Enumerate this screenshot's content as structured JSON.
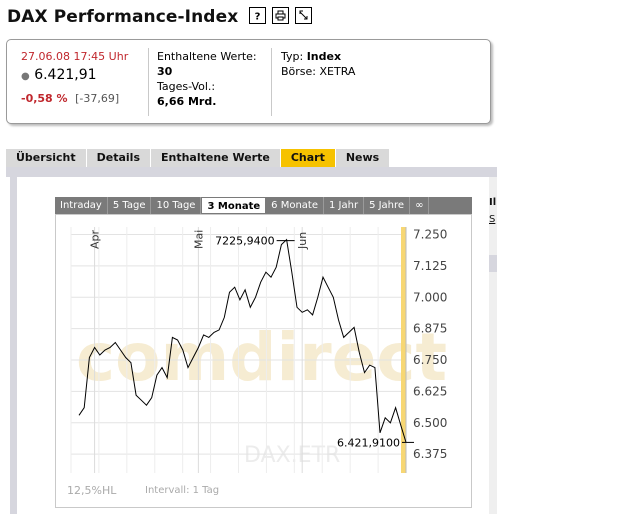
{
  "page": {
    "title": "DAX Performance-Index"
  },
  "toolbar": {
    "icons": [
      "help-icon",
      "print-icon",
      "refresh-icon"
    ]
  },
  "summary": {
    "timestamp": "27.06.08  17:45 Uhr",
    "price": "6.421,91",
    "change_pct": "-0,58 %",
    "change_abs": "[-37,69]",
    "constituents_label": "Enthaltene Werte:",
    "constituents_value": "30",
    "volume_label": "Tages-Vol.:",
    "volume_value": "6,66 Mrd.",
    "type_label": "Typ:",
    "type_value": "Index",
    "exchange_label": "Börse:",
    "exchange_value": "XETRA"
  },
  "tabs": [
    {
      "label": "Übersicht",
      "active": false
    },
    {
      "label": "Details",
      "active": false
    },
    {
      "label": "Enthaltene Werte",
      "active": false
    },
    {
      "label": "Chart",
      "active": true
    },
    {
      "label": "News",
      "active": false
    }
  ],
  "ranges": [
    {
      "label": "Intraday",
      "active": false
    },
    {
      "label": "5 Tage",
      "active": false
    },
    {
      "label": "10 Tage",
      "active": false
    },
    {
      "label": "3 Monate",
      "active": true
    },
    {
      "label": "6 Monate",
      "active": false
    },
    {
      "label": "1 Jahr",
      "active": false
    },
    {
      "label": "5 Jahre",
      "active": false
    },
    {
      "label": "∞",
      "active": false
    }
  ],
  "chart_data": {
    "type": "line",
    "ylim": [
      6300,
      7280
    ],
    "y_ticks": [
      "7.250",
      "7.125",
      "7.000",
      "6.875",
      "6.750",
      "6.625",
      "6.500",
      "6.375"
    ],
    "y_tick_values": [
      7250,
      7125,
      7000,
      6875,
      6750,
      6625,
      6500,
      6375
    ],
    "month_labels": [
      {
        "label": "Apr",
        "index": 3
      },
      {
        "label": "Mai",
        "index": 23
      },
      {
        "label": "Jun",
        "index": 43
      }
    ],
    "n_points": 58,
    "series": [
      {
        "values": [
          6530,
          6560,
          6760,
          6800,
          6770,
          6790,
          6800,
          6820,
          6790,
          6760,
          6740,
          6610,
          6590,
          6570,
          6600,
          6690,
          6720,
          6680,
          6840,
          6830,
          6790,
          6720,
          6760,
          6800,
          6850,
          6840,
          6860,
          6870,
          6920,
          7020,
          7040,
          6990,
          7030,
          6960,
          7000,
          7060,
          7100,
          7080,
          7120,
          7210,
          7230,
          7100,
          6960,
          6940,
          6950,
          6930,
          7000,
          7080,
          7040,
          7000,
          6910,
          6840,
          6860,
          6880,
          6780,
          6700,
          6730,
          6720,
          6460,
          6520,
          6500,
          6560,
          6490,
          6421.91
        ]
      }
    ],
    "annotations": [
      {
        "label": "7225,9400",
        "value": 7225.94,
        "kind": "max"
      },
      {
        "label": "6.421,9100",
        "value": 6421.91,
        "kind": "last"
      }
    ],
    "watermark": "comdirect",
    "symbol_watermark": "DAX.ETR",
    "footer_scale": "12,5%HL",
    "footer_interval": "Intervall: 1 Tag"
  },
  "right_stub": {
    "title": "Il",
    "link": "S"
  }
}
